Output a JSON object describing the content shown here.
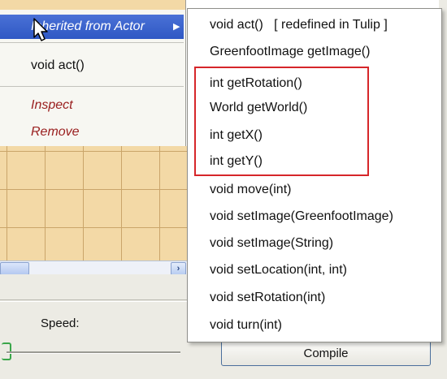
{
  "left_menu": {
    "inherited_label": "Inherited from Actor",
    "submenu_arrow": "▶",
    "act_item": "void act()",
    "inspect_item": "Inspect",
    "remove_item": "Remove"
  },
  "submenu": {
    "items": [
      "void act()   [ redefined in Tulip ]",
      "GreenfootImage getImage()",
      "int getRotation()",
      "World getWorld()",
      "int getX()",
      "int getY()",
      "void move(int)",
      "void setImage(GreenfootImage)",
      "void setImage(String)",
      "void setLocation(int, int)",
      "void setRotation(int)",
      "void turn(int)"
    ]
  },
  "controls": {
    "speed_label": "Speed:",
    "compile_label": "Compile",
    "scroll_arrow": "›"
  },
  "colors": {
    "highlight": "#2f58c4",
    "annotation_box": "#d6262a",
    "grid_background": "#f3d9a6",
    "menu_action_text": "#9a2020"
  }
}
